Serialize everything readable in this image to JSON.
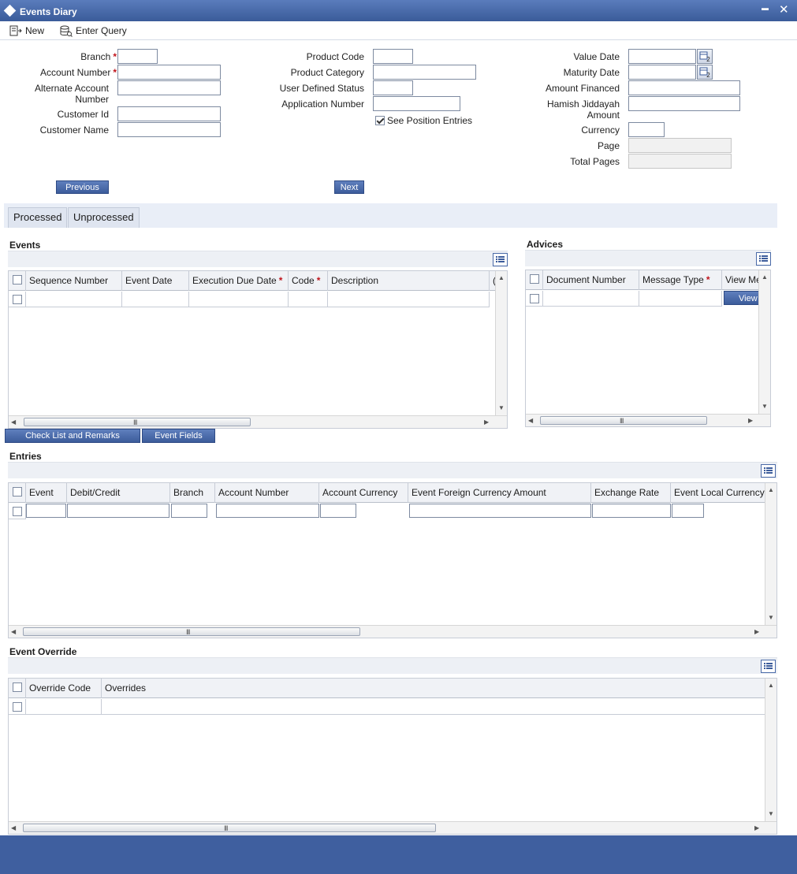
{
  "window": {
    "title": "Events Diary",
    "minimize": "▬",
    "close": "✕"
  },
  "toolbar": {
    "new_label": "New",
    "enter_query_label": "Enter Query"
  },
  "form": {
    "branch_label": "Branch",
    "account_number_label": "Account Number",
    "alternate_account_label_1": "Alternate Account",
    "alternate_account_label_2": "Number",
    "customer_id_label": "Customer Id",
    "customer_name_label": "Customer Name",
    "product_code_label": "Product Code",
    "product_category_label": "Product Category",
    "user_defined_status_label": "User Defined Status",
    "application_number_label": "Application Number",
    "see_position_entries_label": "See Position Entries",
    "see_position_entries_checked": true,
    "value_date_label": "Value Date",
    "maturity_date_label": "Maturity Date",
    "amount_financed_label": "Amount Financed",
    "hamish_label_1": "Hamish Jiddayah",
    "hamish_label_2": "Amount",
    "currency_label": "Currency",
    "page_label": "Page",
    "total_pages_label": "Total Pages",
    "required_marker": "*"
  },
  "nav": {
    "previous_label": "Previous",
    "next_label": "Next"
  },
  "tabs": [
    {
      "label": "Processed"
    },
    {
      "label": "Unprocessed"
    }
  ],
  "events": {
    "title": "Events",
    "columns": [
      "Sequence Number",
      "Event Date",
      "Execution Due Date",
      "Code",
      "Description",
      "("
    ],
    "buttons": {
      "checklist_label": "Check List and Remarks",
      "event_fields_label": "Event Fields"
    }
  },
  "advices": {
    "title": "Advices",
    "columns": [
      "Document Number",
      "Message Type",
      "View Me"
    ],
    "view_button_label": "View"
  },
  "entries": {
    "title": "Entries",
    "columns": [
      "Event",
      "Debit/Credit",
      "Branch",
      "Account Number",
      "Account Currency",
      "Event Foreign Currency Amount",
      "Exchange Rate",
      "Event Local Currency"
    ]
  },
  "override": {
    "title": "Event Override",
    "columns": [
      "Override Code",
      "Overrides"
    ]
  },
  "scroll": {
    "grip": "III",
    "left": "◀",
    "right": "▶",
    "up": "▲",
    "down": "▼"
  }
}
